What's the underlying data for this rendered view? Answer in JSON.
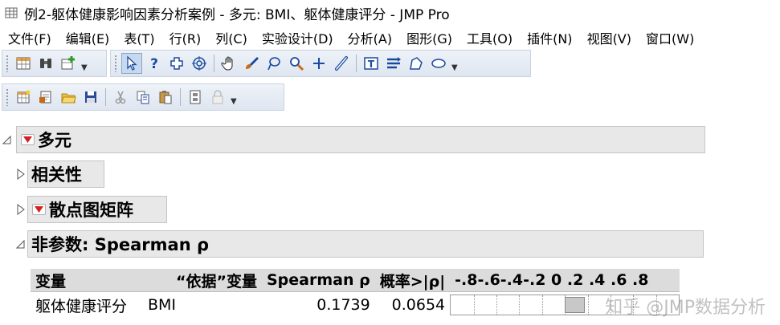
{
  "window": {
    "title": "例2-躯体健康影响因素分析案例 - 多元: BMI、躯体健康评分 - JMP Pro"
  },
  "menubar": {
    "items": [
      "文件(F)",
      "编辑(E)",
      "表(T)",
      "行(R)",
      "列(C)",
      "实验设计(D)",
      "分析(A)",
      "图形(G)",
      "工具(O)",
      "插件(N)",
      "视图(V)",
      "窗口(W)"
    ]
  },
  "toolbar": {
    "row1_group1": [
      "data-table-icon",
      "binoculars-icon",
      "add-table-icon"
    ],
    "row1_group2": [
      "arrow-pointer-icon",
      "help-question-icon",
      "crosshair-icon",
      "target-icon",
      "hand-icon",
      "brush-icon",
      "lasso-icon",
      "magnifier-icon",
      "plus-icon",
      "line-icon",
      "text-annotate-icon",
      "lines-icon",
      "polygon-icon",
      "oval-icon"
    ],
    "row2": [
      "new-table-icon",
      "new-script-icon",
      "open-folder-icon",
      "save-icon",
      "cut-icon",
      "copy-icon",
      "paste-icon",
      "journal-icon",
      "lock-icon"
    ]
  },
  "report": {
    "multivariate": {
      "title": "多元"
    },
    "correlations": {
      "title": "相关性"
    },
    "scatterplot_matrix": {
      "title": "散点图矩阵"
    },
    "spearman": {
      "title": "非参数: Spearman ρ",
      "columns": [
        "变量",
        "“依据”变量",
        "Spearman ρ",
        "概率>|ρ|",
        "-.8-.6-.4-.2 0 .2 .4 .6 .8"
      ],
      "rows": [
        {
          "var": "躯体健康评分",
          "by_var": "BMI",
          "rho": "0.1739",
          "prob": "0.0654",
          "rho_value": 0.1739
        }
      ]
    }
  },
  "watermark": "知乎 @JMP数据分析"
}
